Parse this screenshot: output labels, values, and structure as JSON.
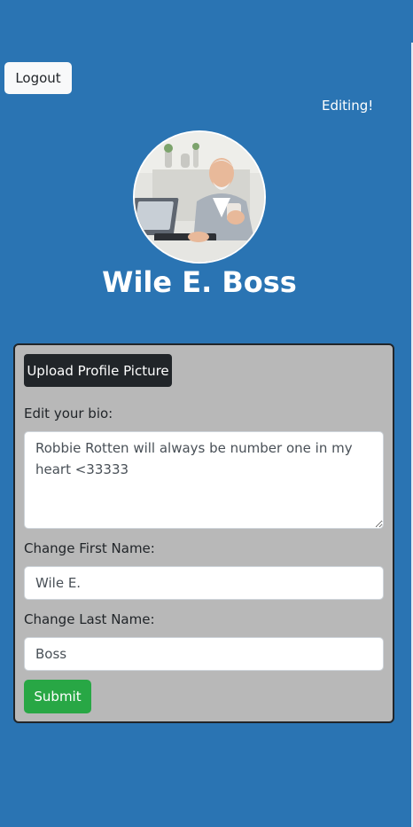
{
  "header": {
    "logout_label": "Logout",
    "status_text": "Editing!"
  },
  "profile": {
    "name": "Wile E. Boss",
    "avatar_icon": "user-photo-icon"
  },
  "edit_form": {
    "upload_label": "Upload Profile Picture",
    "bio_label": "Edit your bio:",
    "bio_value": "Robbie Rotten will always be number one in my heart <33333",
    "first_name_label": "Change First Name:",
    "first_name_value": "Wile E.",
    "last_name_label": "Change Last Name:",
    "last_name_value": "Boss",
    "submit_label": "Submit"
  },
  "colors": {
    "background": "#2a74b3",
    "panel": "#b8b8b8",
    "upload_button": "#212529",
    "submit_button": "#28a745"
  }
}
